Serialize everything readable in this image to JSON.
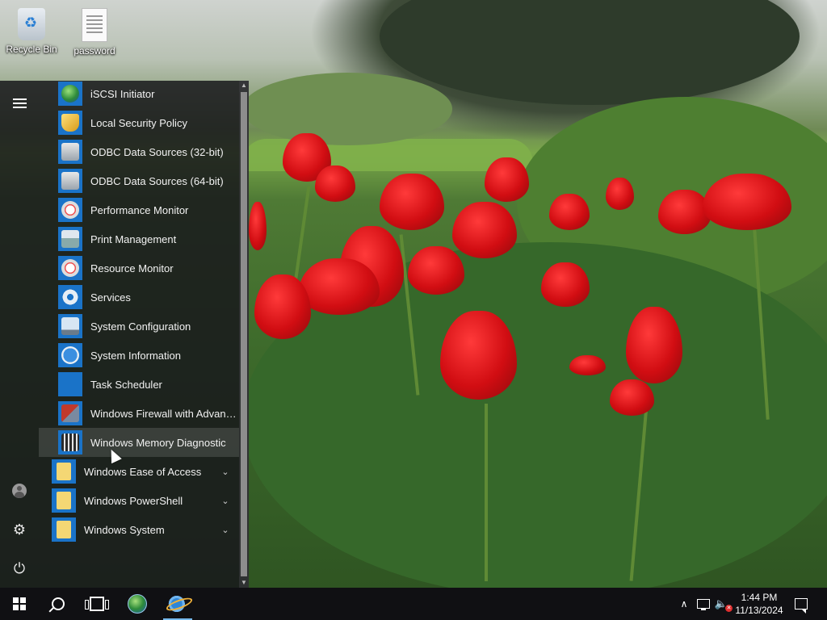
{
  "desktop": {
    "icons": [
      {
        "label": "Recycle Bin",
        "icon": "recycle-bin-icon"
      },
      {
        "label": "password",
        "icon": "text-document-icon"
      }
    ]
  },
  "start_menu": {
    "rail": {
      "menu": "hamburger-menu-icon",
      "user": "user-account-icon",
      "settings": "⚙",
      "power": "⏻"
    },
    "items": [
      {
        "label": "iSCSI Initiator",
        "icon": "globe-icon"
      },
      {
        "label": "Local Security Policy",
        "icon": "security-policy-icon"
      },
      {
        "label": "ODBC Data Sources (32-bit)",
        "icon": "database-icon"
      },
      {
        "label": "ODBC Data Sources (64-bit)",
        "icon": "database-icon"
      },
      {
        "label": "Performance Monitor",
        "icon": "gauge-icon"
      },
      {
        "label": "Print Management",
        "icon": "printer-icon"
      },
      {
        "label": "Resource Monitor",
        "icon": "gauge-icon"
      },
      {
        "label": "Services",
        "icon": "gears-icon"
      },
      {
        "label": "System Configuration",
        "icon": "monitor-icon"
      },
      {
        "label": "System Information",
        "icon": "info-icon"
      },
      {
        "label": "Task Scheduler",
        "icon": "clock-icon"
      },
      {
        "label": "Windows Firewall with Advanced Security",
        "icon": "firewall-icon"
      },
      {
        "label": "Windows Memory Diagnostic",
        "icon": "memory-chip-icon"
      }
    ],
    "folders": [
      {
        "label": "Windows Ease of Access",
        "chevron": "⌄"
      },
      {
        "label": "Windows PowerShell",
        "chevron": "⌄"
      },
      {
        "label": "Windows System",
        "chevron": "⌄"
      }
    ],
    "hovered_item": "Windows Memory Diagnostic",
    "accent_color": "#1a73c8"
  },
  "taskbar": {
    "clock": {
      "time": "1:44 PM",
      "date": "11/13/2024"
    },
    "tray_chevron": "∧",
    "volume": "🔈",
    "volume_muted_badge": "✕",
    "active_indicator_color": "#76b9ed"
  }
}
